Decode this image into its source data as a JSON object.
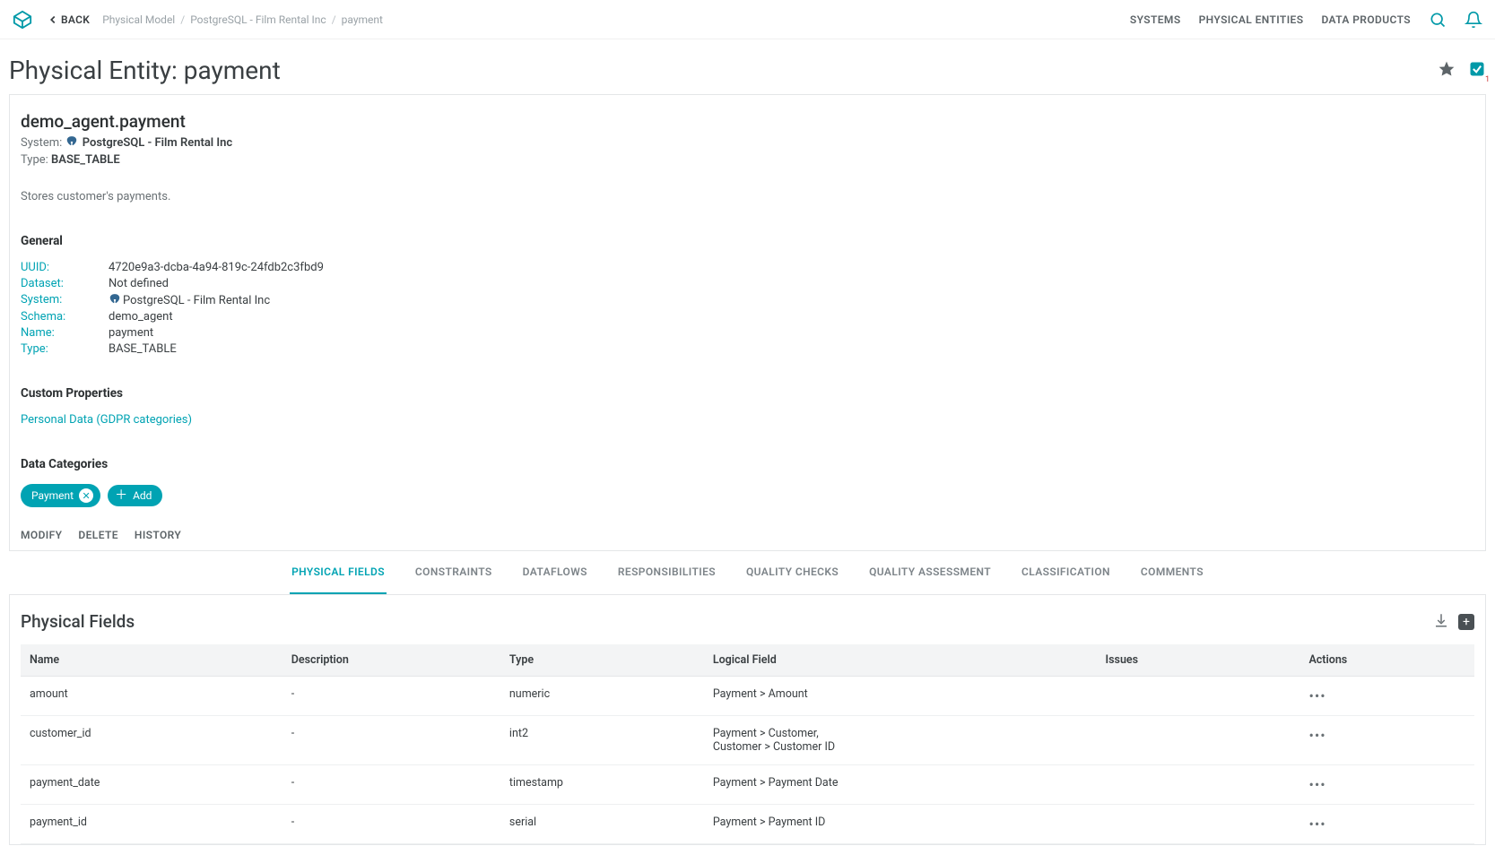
{
  "top": {
    "back": "BACK",
    "breadcrumb": [
      "Physical Model",
      "PostgreSQL - Film Rental Inc",
      "payment"
    ],
    "nav": [
      "SYSTEMS",
      "PHYSICAL ENTITIES",
      "DATA PRODUCTS"
    ]
  },
  "title_prefix": "Physical Entity: ",
  "title_value": "payment",
  "check_badge_sub": "1",
  "entity": {
    "full_name": "demo_agent.payment",
    "system_label": "System:",
    "system_value": "PostgreSQL - Film Rental Inc",
    "type_label": "Type:",
    "type_value": "BASE_TABLE",
    "description": "Stores customer's payments."
  },
  "sections": {
    "general": "General",
    "custom": "Custom Properties",
    "datacat": "Data Categories"
  },
  "general": {
    "uuid_k": "UUID:",
    "uuid_v": "4720e9a3-dcba-4a94-819c-24fdb2c3fbd9",
    "dataset_k": "Dataset:",
    "dataset_v": "Not defined",
    "system_k": "System:",
    "system_v": "PostgreSQL - Film Rental Inc",
    "schema_k": "Schema:",
    "schema_v": "demo_agent",
    "name_k": "Name:",
    "name_v": "payment",
    "type_k": "Type:",
    "type_v": "BASE_TABLE"
  },
  "custom_link": "Personal Data (GDPR categories)",
  "datacat": {
    "chip": "Payment",
    "add": "Add"
  },
  "cardActions": [
    "MODIFY",
    "DELETE",
    "HISTORY"
  ],
  "tabs": [
    "PHYSICAL FIELDS",
    "CONSTRAINTS",
    "DATAFLOWS",
    "RESPONSIBILITIES",
    "QUALITY CHECKS",
    "QUALITY ASSESSMENT",
    "CLASSIFICATION",
    "COMMENTS"
  ],
  "fields": {
    "heading": "Physical Fields",
    "columns": [
      "Name",
      "Description",
      "Type",
      "Logical Field",
      "Issues",
      "Actions"
    ],
    "rows": [
      {
        "name": "amount",
        "desc": "-",
        "type": "numeric",
        "logical": "Payment > Amount"
      },
      {
        "name": "customer_id",
        "desc": "-",
        "type": "int2",
        "logical": "Payment > Customer,\nCustomer > Customer  ID"
      },
      {
        "name": "payment_date",
        "desc": "-",
        "type": "timestamp",
        "logical": "Payment > Payment Date"
      },
      {
        "name": "payment_id",
        "desc": "-",
        "type": "serial",
        "logical": "Payment > Payment  ID"
      }
    ]
  }
}
